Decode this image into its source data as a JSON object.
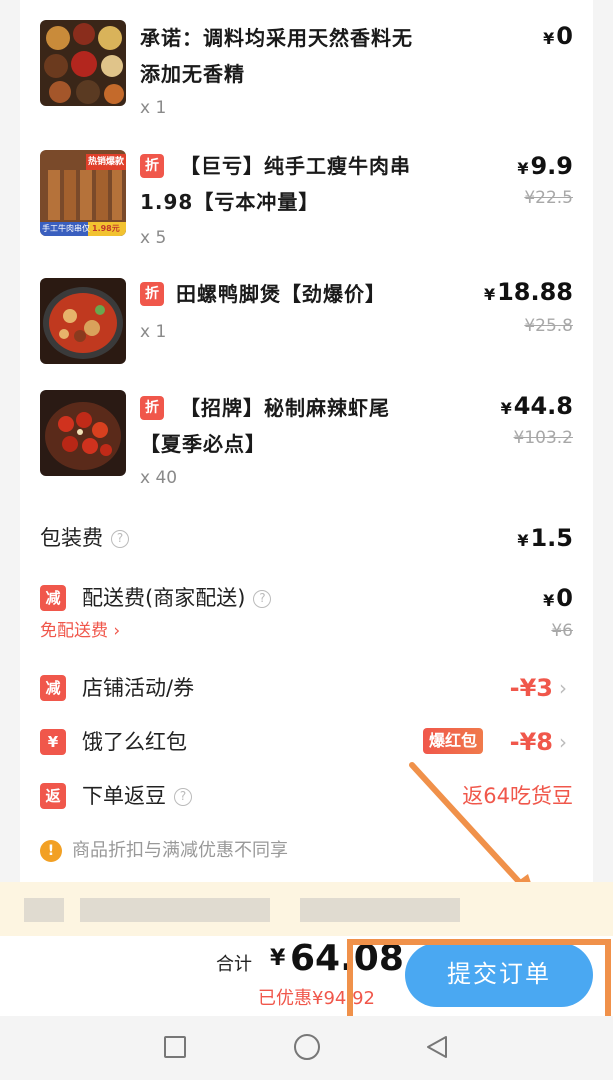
{
  "items": [
    {
      "name_line1": "承诺：调料均采用天然香料无",
      "name_line2": "添加无香精",
      "qty": "x 1",
      "price": "0",
      "orig": "",
      "discount_badge": ""
    },
    {
      "name_line1": "【巨亏】纯手工瘦牛肉串",
      "name_line2": "1.98【亏本冲量】",
      "qty": "x 5",
      "price": "9.9",
      "orig": "¥22.5",
      "discount_badge": "折",
      "thumb_caption_top": "热销爆款",
      "thumb_caption_left": "手工牛肉串仅",
      "thumb_caption_right": "1.98元"
    },
    {
      "name_line1": "田螺鸭脚煲【劲爆价】",
      "name_line2": "",
      "qty": "x 1",
      "price": "18.88",
      "orig": "¥25.8",
      "discount_badge": "折"
    },
    {
      "name_line1": "【招牌】秘制麻辣虾尾",
      "name_line2": "【夏季必点】",
      "qty": "x 40",
      "price": "44.8",
      "orig": "¥103.2",
      "discount_badge": "折"
    }
  ],
  "yen": "¥",
  "fees": {
    "packaging_label": "包装费",
    "packaging_value": "1.5",
    "delivery_label": "配送费(商家配送)",
    "delivery_badge": "减",
    "delivery_value": "0",
    "delivery_sub_label": "免配送费",
    "delivery_orig": "¥6",
    "store_label": "店铺活动/券",
    "store_badge": "减",
    "store_value": "-¥3",
    "hongbao_label": "饿了么红包",
    "hongbao_badge": "¥",
    "hongbao_tag": "爆红包",
    "hongbao_value": "-¥8",
    "beans_label": "下单返豆",
    "beans_badge": "返",
    "beans_value": "返64吃货豆",
    "question_mark": "?",
    "notice_icon": "!",
    "notice_text": "商品折扣与满减优惠不同享"
  },
  "bottom": {
    "total_label": "合计",
    "total_value": "64.08",
    "saved": "已优惠¥94.92",
    "submit": "提交订单"
  },
  "colors": {
    "accent_red": "#f0574b",
    "submit_blue": "#4aa8f2",
    "annotation_orange": "#f0914a"
  },
  "icons": {
    "square": "recent-apps-icon",
    "circle": "home-icon",
    "triangle": "back-icon"
  }
}
